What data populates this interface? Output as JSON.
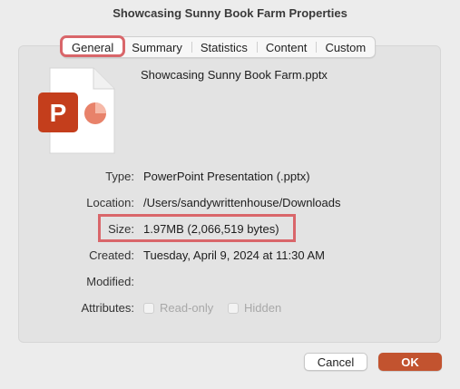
{
  "window": {
    "title": "Showcasing Sunny Book Farm Properties"
  },
  "tabs": [
    {
      "label": "General",
      "active": true
    },
    {
      "label": "Summary"
    },
    {
      "label": "Statistics"
    },
    {
      "label": "Content"
    },
    {
      "label": "Custom"
    }
  ],
  "file": {
    "name": "Showcasing Sunny Book Farm.pptx",
    "icon": "powerpoint-file-icon",
    "icon_letter": "P"
  },
  "properties": {
    "type": {
      "label": "Type:",
      "value": "PowerPoint Presentation (.pptx)"
    },
    "location": {
      "label": "Location:",
      "value": "/Users/sandywrittenhouse/Downloads"
    },
    "size": {
      "label": "Size:",
      "value": "1.97MB (2,066,519 bytes)"
    },
    "created": {
      "label": "Created:",
      "value": "Tuesday, April 9, 2024 at 11:30 AM"
    },
    "modified": {
      "label": "Modified:",
      "value": ""
    },
    "attributes": {
      "label": "Attributes:",
      "read_only": {
        "label": "Read-only",
        "checked": false
      },
      "hidden": {
        "label": "Hidden",
        "checked": false
      }
    }
  },
  "buttons": {
    "cancel": "Cancel",
    "ok": "OK"
  },
  "colors": {
    "accent": "#c2532f",
    "annotation": "#d9666a",
    "powerpoint": "#c43e1c"
  }
}
